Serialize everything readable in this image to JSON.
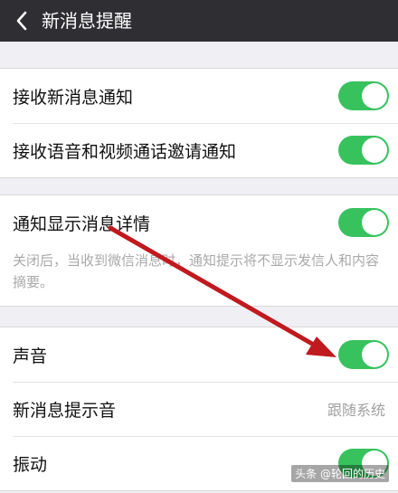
{
  "header": {
    "title": "新消息提醒",
    "back_icon": "chevron-left-icon"
  },
  "colors": {
    "toggle_on": "#37c25e",
    "header_bg": "#2e2e33",
    "annotation_arrow": "#c0191e"
  },
  "group1": {
    "items": [
      {
        "label": "接收新消息通知",
        "enabled": true
      },
      {
        "label": "接收语音和视频通话邀请通知",
        "enabled": true
      }
    ]
  },
  "group2": {
    "item": {
      "label": "通知显示消息详情",
      "enabled": true
    },
    "description": "关闭后，当收到微信消息时，通知提示将不显示发信人和内容摘要。"
  },
  "group3": {
    "sound": {
      "label": "声音",
      "enabled": true
    },
    "ringtone": {
      "label": "新消息提示音",
      "value": "跟随系统"
    },
    "vibrate": {
      "label": "振动",
      "enabled": true
    }
  },
  "watermark": "头条 @轮回的历史"
}
